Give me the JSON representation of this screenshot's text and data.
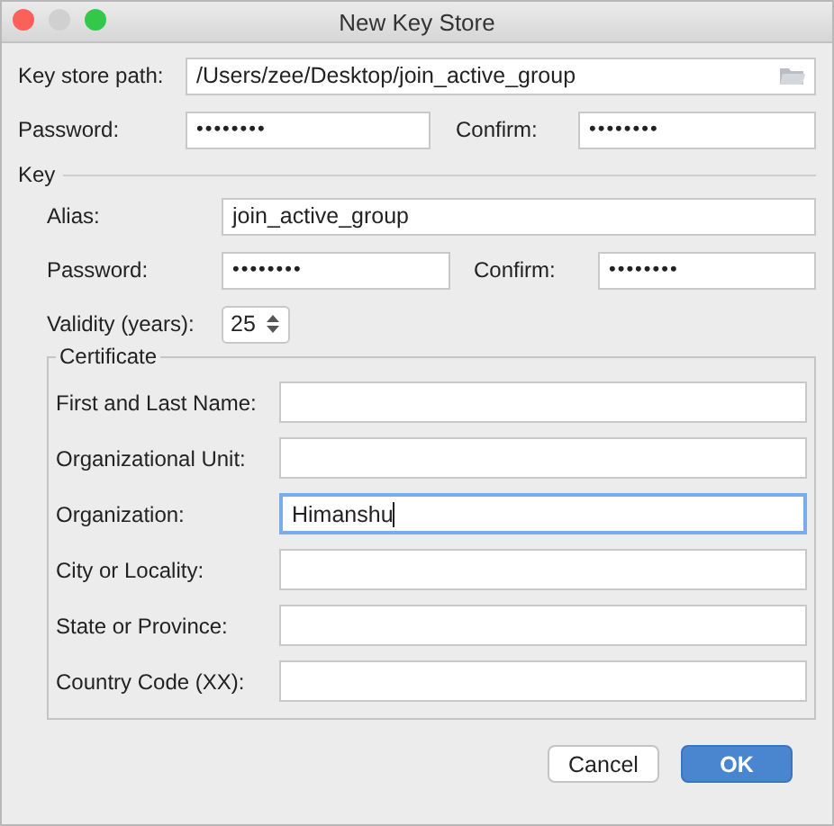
{
  "window": {
    "title": "New Key Store"
  },
  "key_store": {
    "path_label": "Key store path:",
    "path": "/Users/zee/Desktop/join_active_group",
    "password_label": "Password:",
    "password": "••••••••",
    "confirm_label": "Confirm:",
    "confirm": "••••••••"
  },
  "key": {
    "legend": "Key",
    "alias_label": "Alias:",
    "alias": "join_active_group",
    "password_label": "Password:",
    "password": "••••••••",
    "confirm_label": "Confirm:",
    "confirm": "••••••••",
    "validity_label": "Validity (years):",
    "validity": "25"
  },
  "certificate": {
    "legend": "Certificate",
    "fields": [
      {
        "label": "First and Last Name:",
        "focused": false
      },
      {
        "label": "Organizational Unit:",
        "focused": false
      },
      {
        "label": "Organization:",
        "value": "Himanshu",
        "focused": true
      },
      {
        "label": "City or Locality:",
        "focused": false
      },
      {
        "label": "State or Province:",
        "focused": false
      },
      {
        "label": "Country Code (XX):",
        "focused": false
      }
    ]
  },
  "buttons": [
    {
      "label": "Cancel",
      "kind": "secondary"
    },
    {
      "label": "OK",
      "kind": "primary"
    }
  ]
}
